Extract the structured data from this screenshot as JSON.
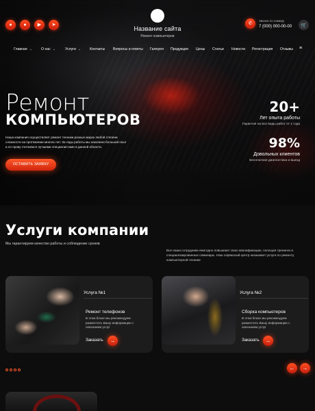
{
  "header": {
    "site_name": "Название сайта",
    "site_subtitle": "Ремонт компьютеров",
    "phone_label": "Звонок по номеру",
    "phone_number": "7 (000) 000-00-00",
    "social_icons": [
      "vk-icon",
      "odnoklassniki-icon",
      "youtube-icon",
      "telegram-icon"
    ]
  },
  "nav": {
    "items": [
      {
        "label": "Главная"
      },
      {
        "label": "О нас"
      },
      {
        "label": "Услуги"
      },
      {
        "label": "Контакты"
      },
      {
        "label": "Вопросы и ответы"
      },
      {
        "label": "Галерея"
      },
      {
        "label": "Продукция"
      },
      {
        "label": "Цены"
      },
      {
        "label": "Статьи"
      },
      {
        "label": "Новости"
      },
      {
        "label": "Регистрация"
      },
      {
        "label": "Отзывы"
      }
    ]
  },
  "hero": {
    "title_line1": "Ремонт",
    "title_line2": "КОМПЬЮТЕРОВ",
    "description": "Наша компания осуществляет ремонт техники разных марок любой степени сложности на протяжении многих лет. За годы работы мы накопили большой опыт и по праву считаемся лучшими специалистами в данной области.",
    "cta_label": "ОСТАВИТЬ ЗАЯВКУ",
    "stats": [
      {
        "value": "20+",
        "label": "Лет опыта работы",
        "sub": "Гарантия на все виды работ от 1 года"
      },
      {
        "value": "98%",
        "label": "Довольных клиентов",
        "sub": "Бесплатная диагностика и выезд"
      }
    ]
  },
  "services": {
    "title": "Услуги компании",
    "subtitle": "Мы гарантируем качество работы и соблюдение сроков",
    "note": "Все наши сотрудники ежегодно повышают свою квалификацию, посещая тренинги и специализированные семинары. Наш сервисный центр оказывает услуги по ремонту компьютерной техники",
    "cards": [
      {
        "number": "Услуга №1",
        "title": "Ремонт телефонов",
        "text": "В этом блоке мы рекомендуем разместить Вашу информацию с описанием услуг",
        "order_label": "Заказать"
      },
      {
        "number": "Услуга №2",
        "title": "Сборка компьютеров",
        "text": "В этом блоке мы рекомендуем разместить Вашу информацию с описанием услуг",
        "order_label": "Заказать"
      }
    ],
    "arrows": {
      "prev": "←",
      "next": "→"
    }
  },
  "colors": {
    "accent": "#ff4a1f",
    "background": "#0d0d0d",
    "card": "#1c1c1c"
  }
}
